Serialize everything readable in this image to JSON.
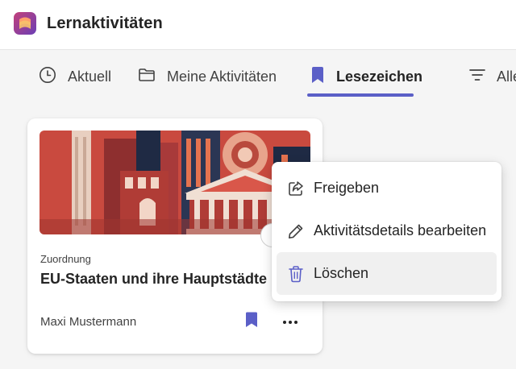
{
  "app": {
    "title": "Lernaktivitäten",
    "logo_icon": "app-logo-icon",
    "accent_color": "#5b5fc7"
  },
  "tabs": [
    {
      "label": "Aktuell",
      "icon": "clock-icon",
      "active": false
    },
    {
      "label": "Meine Aktivitäten",
      "icon": "folder-icon",
      "active": false
    },
    {
      "label": "Lesezeichen",
      "icon": "bookmark-icon",
      "active": true
    },
    {
      "label": "Alle",
      "icon": "filter-icon",
      "active": false
    }
  ],
  "card": {
    "type": "Zuordnung",
    "title": "EU-Staaten und ihre Hauptstädte",
    "author": "Maxi Mustermann",
    "bookmark_icon": "bookmark-filled-icon",
    "more_icon": "more-horizontal-icon"
  },
  "menu": {
    "items": [
      {
        "label": "Freigeben",
        "icon": "share-icon"
      },
      {
        "label": "Aktivitätsdetails bearbeiten",
        "icon": "pencil-icon"
      },
      {
        "label": "Löschen",
        "icon": "trash-icon",
        "highlighted": true
      }
    ]
  }
}
